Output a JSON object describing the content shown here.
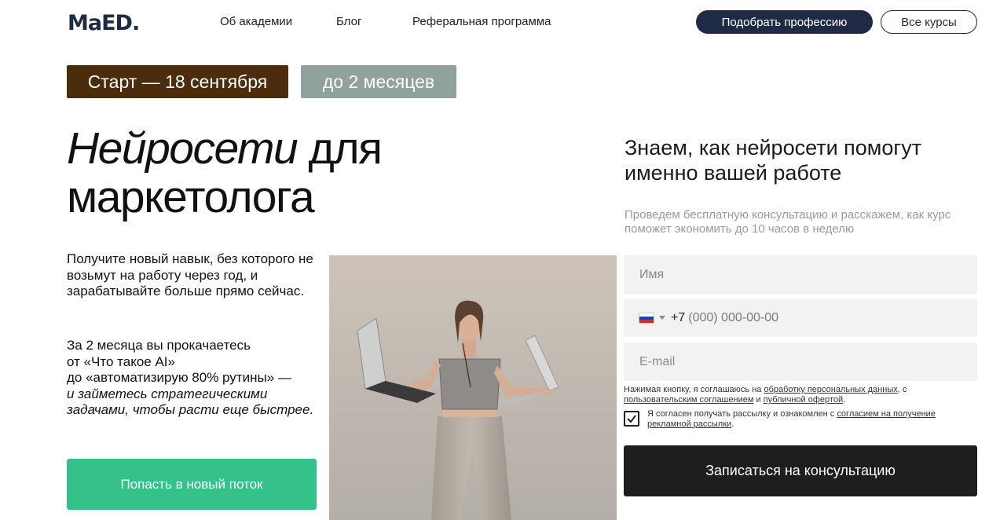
{
  "header": {
    "logo": "MaED.",
    "nav": [
      "Об академии",
      "Блог",
      "Реферальная программа"
    ],
    "pick_button": "Подобрать профессию",
    "all_courses_button": "Все курсы"
  },
  "badges": {
    "start": "Старт —  18 сентября",
    "duration": "до 2 месяцев"
  },
  "hero": {
    "title_italic": "Нейросети",
    "title_rest1": " для",
    "title_rest2": "маркетолога",
    "para1": "Получите новый навык, без которого не возьмут на работу через год, и зарабатывайте больше прямо сейчас.",
    "para2_l1": "За 2 месяца вы прокачаетесь",
    "para2_l2": "от «Что такое AI»",
    "para2_l3": "до «автоматизирую 80% рутины» —",
    "para2_italic": "и займетесь стратегическими задачами, чтобы расти еще быстрее.",
    "cta": "Попасть в новый поток"
  },
  "form": {
    "title": "Знаем, как нейросети помогут именно вашей работе",
    "subtitle": "Проведем бесплатную консультацию и расскажем, как курс поможет экономить до 10 часов в неделю",
    "name_placeholder": "Имя",
    "phone_code": "+7",
    "phone_placeholder": "(000) 000-00-00",
    "email_placeholder": "E-mail",
    "consent_prefix": "Нажимая кнопку, я соглашаюсь на ",
    "consent_link1": "обработку персональных данных",
    "consent_mid1": ", с ",
    "consent_link2": "пользовательским соглашением",
    "consent_mid2": " и ",
    "consent_link3": "публичной офертой",
    "consent_end": ".",
    "checkbox_prefix": "Я согласен получать рассылку и ознакомлен с ",
    "checkbox_link": "согласием на получение рекламной рассылки",
    "checkbox_end": ".",
    "checkbox_checked": true,
    "submit": "Записаться на консультацию"
  },
  "colors": {
    "navy": "#1f2a44",
    "brown": "#4b2d0e",
    "sage": "#8fa39a",
    "green": "#34c28a",
    "dark": "#1e1e1e"
  }
}
